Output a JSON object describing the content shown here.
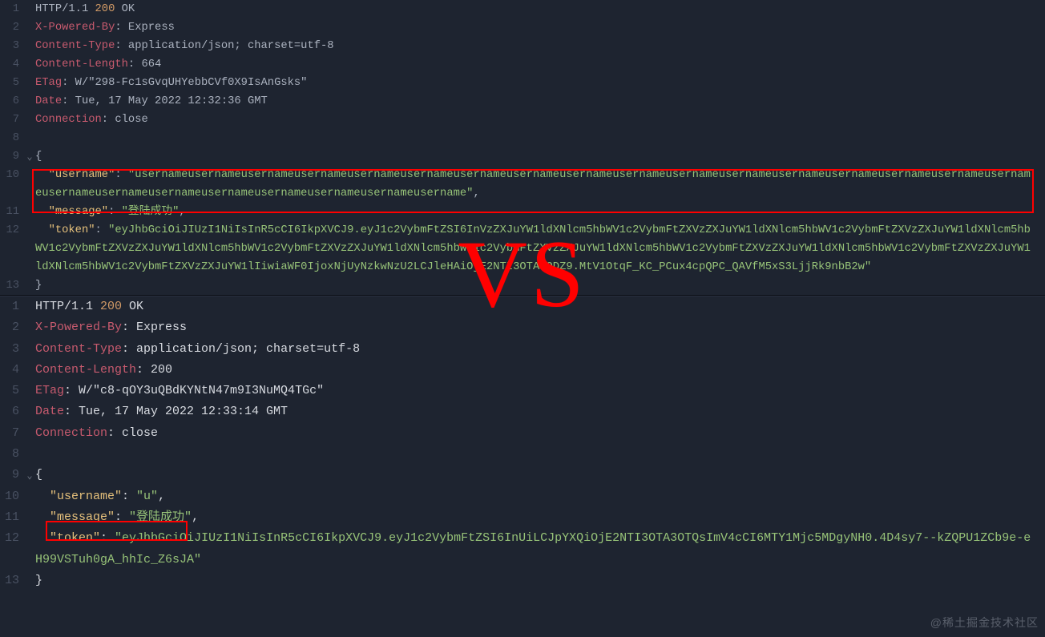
{
  "watermark": "@稀土掘金技术社区",
  "vs": "VS",
  "top": {
    "lines": [
      {
        "n": "1",
        "fold": "",
        "html": "<span class='pln'>HTTP/1.1 </span><span class='num'>200</span><span class='pln'> OK</span>"
      },
      {
        "n": "2",
        "fold": "",
        "html": "<span class='hdr'>X-Powered-By</span><span class='pln'>: Express</span>"
      },
      {
        "n": "3",
        "fold": "",
        "html": "<span class='hdr'>Content-Type</span><span class='pln'>: application/json; charset=utf-8</span>"
      },
      {
        "n": "4",
        "fold": "",
        "html": "<span class='hdr'>Content-Length</span><span class='pln'>: 664</span>"
      },
      {
        "n": "5",
        "fold": "",
        "html": "<span class='hdr'>ETag</span><span class='pln'>: W/\"298-Fc1sGvqUHYebbCVf0X9IsAnGsks\"</span>"
      },
      {
        "n": "6",
        "fold": "",
        "html": "<span class='hdr'>Date</span><span class='pln'>: Tue, 17 May 2022 12:32:36 GMT</span>"
      },
      {
        "n": "7",
        "fold": "",
        "html": "<span class='hdr'>Connection</span><span class='pln'>: close</span>"
      },
      {
        "n": "8",
        "fold": "",
        "html": ""
      },
      {
        "n": "9",
        "fold": "⌄",
        "html": "<span class='pln'>{</span>"
      },
      {
        "n": "10",
        "fold": "",
        "html": "<span class='pln'>  </span><span class='key'>\"username\"</span><span class='pln'>: </span><span class='str'>\"usernameusernameusernameusernameusernameusernameusernameusernameusernameusernameusernameusernameusernameusernameusernameusernameusernameusernameusernameusernameusernameusernameusernameusernameusername\"</span><span class='pln'>,</span>"
      },
      {
        "n": "11",
        "fold": "",
        "html": "<span class='pln'>  </span><span class='key'>\"message\"</span><span class='pln'>: </span><span class='str'>\"登陆成功\"</span><span class='pln'>,</span>"
      },
      {
        "n": "12",
        "fold": "",
        "html": "<span class='pln'>  </span><span class='key'>\"token\"</span><span class='pln'>: </span><span class='str'>\"eyJhbGciOiJIUzI1NiIsInR5cCI6IkpXVCJ9.eyJ1c2VybmFtZSI6InVzZXJuYW1ldXNlcm5hbWV1c2VybmFtZXVzZXJuYW1ldXNlcm5hbWV1c2VybmFtZXVzZXJuYW1ldXNlcm5hbWV1c2VybmFtZXVzZXJuYW1ldXNlcm5hbWV1c2VybmFtZXVzZXJuYW1ldXNlcm5hbWV1c2VybmFtZXVzZXJuYW1ldXNlcm5hbWV1c2VybmFtZXVzZXJuYW1ldXNlcm5hbWV1c2VybmFtZXVzZXJuYW1ldXNlcm5hbWV1c2VybmFtZXVzZXJuYW1lIiwiaWF0IjoxNjUyNzkwNzU2LCJleHAiOjE2NTI3OTA3ODZ9.MtV1OtqF_KC_PCux4cpQPC_QAVfM5xS3LjjRk9nbB2w\"</span>"
      },
      {
        "n": "13",
        "fold": "",
        "html": "<span class='pln'>}</span>"
      }
    ]
  },
  "bottom": {
    "lines": [
      {
        "n": "1",
        "fold": "",
        "html": "<span class='white'>HTTP/1.1 </span><span class='num'>200</span><span class='white'> OK</span>"
      },
      {
        "n": "2",
        "fold": "",
        "html": "<span class='hdr'>X-Powered-By</span><span class='white'>: Express</span>"
      },
      {
        "n": "3",
        "fold": "",
        "html": "<span class='hdr'>Content-Type</span><span class='white'>: application/json; charset=utf-8</span>"
      },
      {
        "n": "4",
        "fold": "",
        "html": "<span class='hdr'>Content-Length</span><span class='white'>: 200</span>"
      },
      {
        "n": "5",
        "fold": "",
        "html": "<span class='hdr'>ETag</span><span class='white'>: W/\"c8-qOY3uQBdKYNtN47m9I3NuMQ4TGc\"</span>"
      },
      {
        "n": "6",
        "fold": "",
        "html": "<span class='hdr'>Date</span><span class='white'>: Tue, 17 May 2022 12:33:14 GMT</span>"
      },
      {
        "n": "7",
        "fold": "",
        "html": "<span class='hdr'>Connection</span><span class='white'>: close</span>"
      },
      {
        "n": "8",
        "fold": "",
        "html": ""
      },
      {
        "n": "9",
        "fold": "⌄",
        "html": "<span class='white'>{</span>"
      },
      {
        "n": "10",
        "fold": "",
        "html": "<span class='white'>  </span><span class='key'>\"username\"</span><span class='white'>: </span><span class='str'>\"u\"</span><span class='white'>,</span>"
      },
      {
        "n": "11",
        "fold": "",
        "html": "<span class='white'>  </span><span class='key'>\"message\"</span><span class='white'>: </span><span class='str'>\"登陆成功\"</span><span class='white'>,</span>"
      },
      {
        "n": "12",
        "fold": "",
        "html": "<span class='white'>  </span><span class='key'>\"token\"</span><span class='white'>: </span><span class='str'>\"eyJhbGciOiJIUzI1NiIsInR5cCI6IkpXVCJ9.eyJ1c2VybmFtZSI6InUiLCJpYXQiOjE2NTI3OTA3OTQsImV4cCI6MTY1Mjc5MDgyNH0.4D4sy7--kZQPU1ZCb9e-eH99VSTuh0gA_hhIc_Z6sJA\"</span>"
      },
      {
        "n": "13",
        "fold": "",
        "html": "<span class='white'>}</span>"
      }
    ]
  }
}
